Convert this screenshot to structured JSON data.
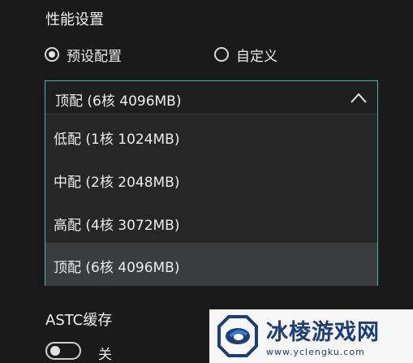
{
  "performance": {
    "title": "性能设置",
    "radios": [
      {
        "label": "预设配置",
        "checked": true
      },
      {
        "label": "自定义",
        "checked": false
      }
    ]
  },
  "select": {
    "value": "顶配 (6核 4096MB)",
    "open": true,
    "options": [
      {
        "label": "低配 (1核 1024MB)",
        "highlighted": false
      },
      {
        "label": "中配 (2核 2048MB)",
        "highlighted": false
      },
      {
        "label": "高配 (4核 3072MB)",
        "highlighted": false
      },
      {
        "label": "顶配 (6核 4096MB)",
        "highlighted": true
      }
    ],
    "border_color": "#2fbea8"
  },
  "astc": {
    "title": "ASTC缓存",
    "toggle_on": false,
    "toggle_label": "关"
  },
  "watermark": {
    "title": "冰棱游戏网",
    "url": "www.yclengku.com"
  },
  "colors": {
    "background": "#1a1a1a",
    "accent": "#2fbea8",
    "highlight_row": "#3a3c3e",
    "watermark_text": "#1b3d78"
  }
}
